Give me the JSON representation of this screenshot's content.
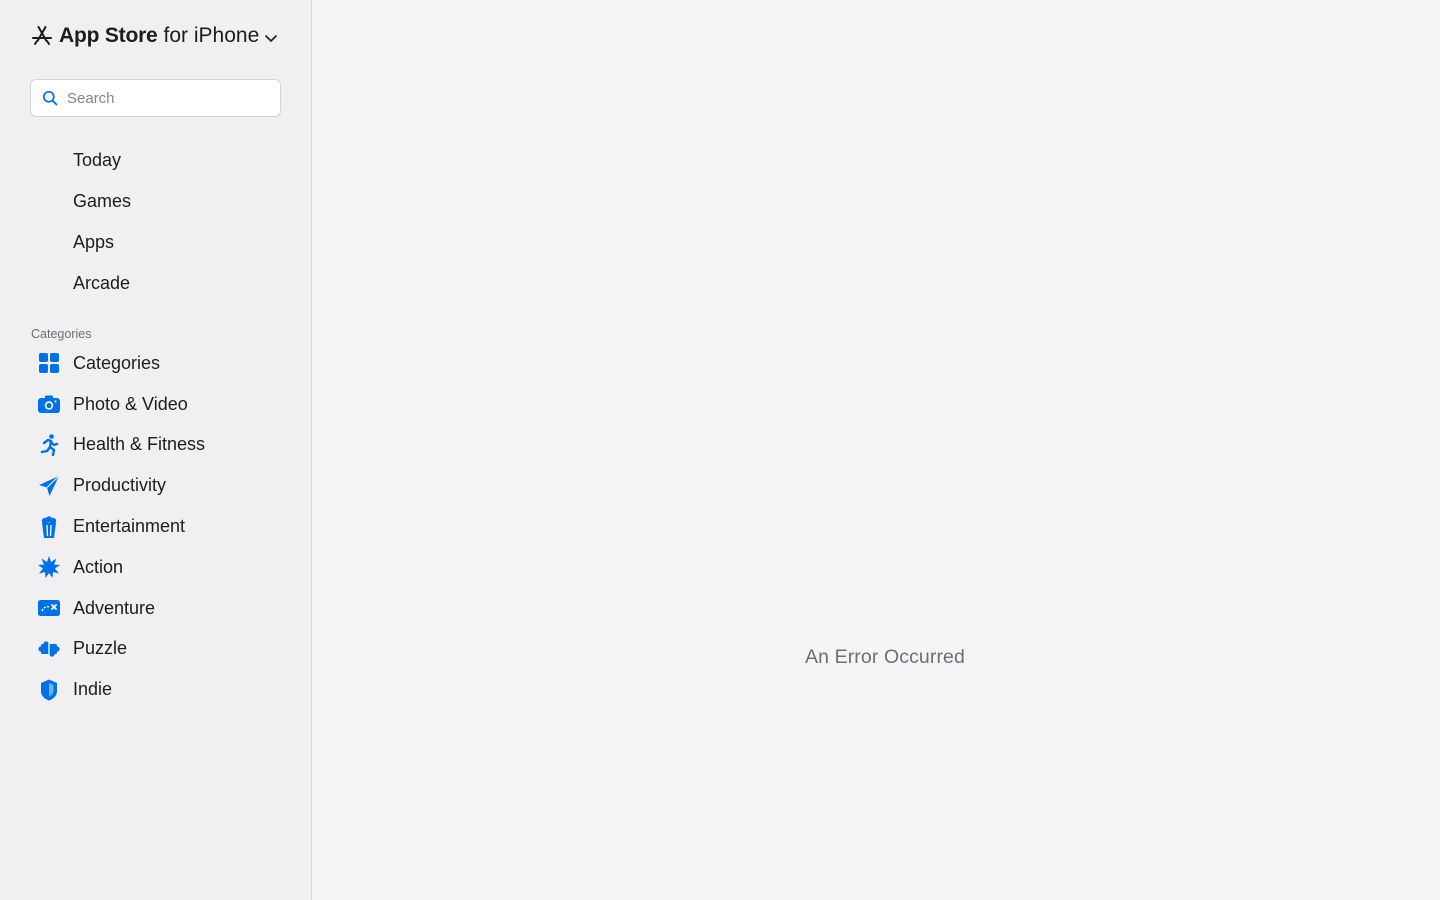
{
  "header": {
    "brand_strong": "App Store",
    "brand_light": "for iPhone",
    "brand_icon": "app-store-icon",
    "chevron_icon": "chevron-down-icon"
  },
  "search": {
    "placeholder": "Search",
    "value": "",
    "icon": "search-icon"
  },
  "nav": {
    "items": [
      {
        "label": "Today"
      },
      {
        "label": "Games"
      },
      {
        "label": "Apps"
      },
      {
        "label": "Arcade"
      }
    ]
  },
  "categories": {
    "section_label": "Categories",
    "items": [
      {
        "label": "Categories",
        "icon": "grid-icon"
      },
      {
        "label": "Photo & Video",
        "icon": "camera-icon"
      },
      {
        "label": "Health & Fitness",
        "icon": "running-figure-icon"
      },
      {
        "label": "Productivity",
        "icon": "paper-plane-icon"
      },
      {
        "label": "Entertainment",
        "icon": "popcorn-icon"
      },
      {
        "label": "Action",
        "icon": "burst-icon"
      },
      {
        "label": "Adventure",
        "icon": "map-icon"
      },
      {
        "label": "Puzzle",
        "icon": "puzzle-piece-icon"
      },
      {
        "label": "Indie",
        "icon": "shield-icon"
      }
    ]
  },
  "main": {
    "message": "An Error Occurred"
  },
  "colors": {
    "accent": "#0071e3",
    "sidebar_bg": "#f0f0f2",
    "main_bg": "#f5f5f7",
    "text": "#1d1d1f",
    "muted": "#6e6e73"
  }
}
